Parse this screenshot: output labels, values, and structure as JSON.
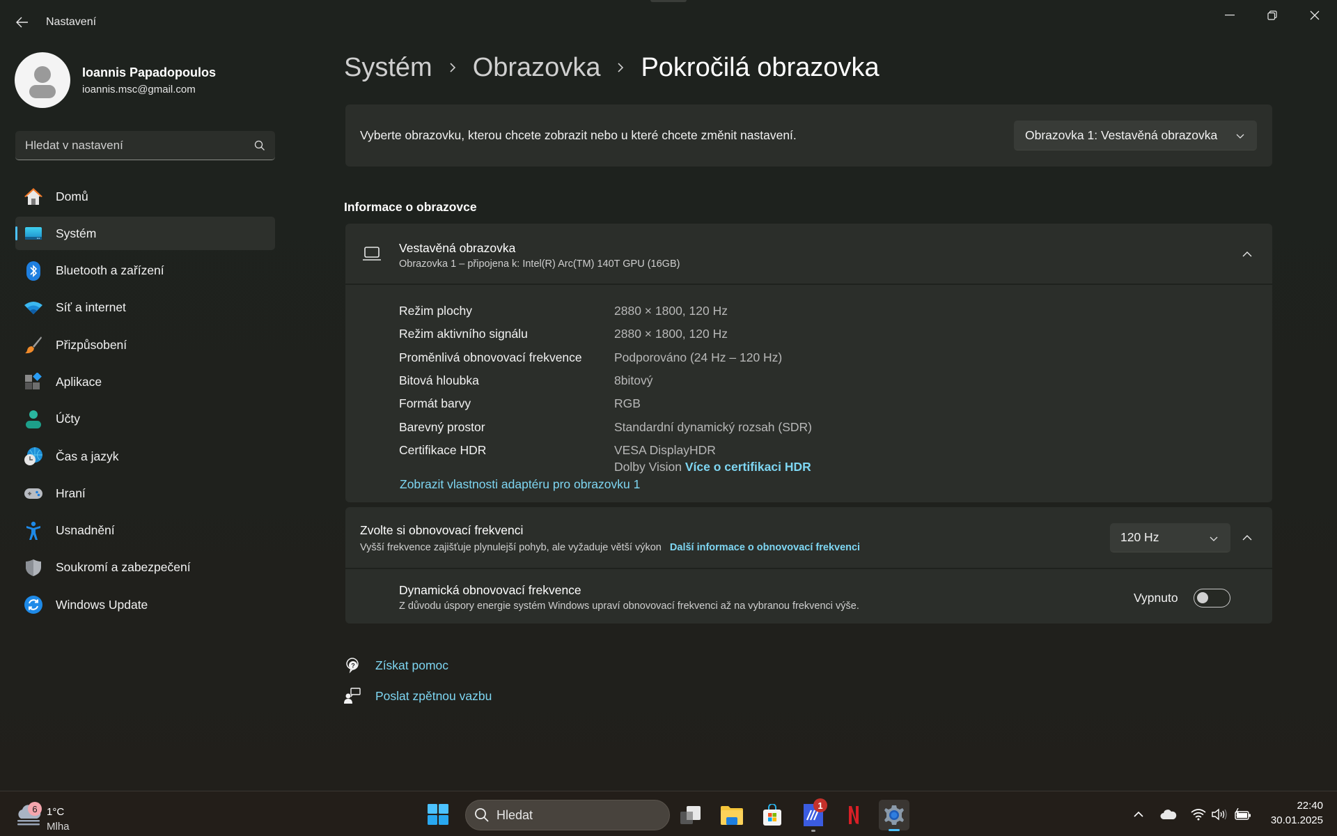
{
  "window": {
    "app_title": "Nastavení",
    "controls": {
      "minimize": "minimize",
      "maximize": "restore",
      "close": "close"
    }
  },
  "user": {
    "name": "Ioannis Papadopoulos",
    "email": "ioannis.msc@gmail.com"
  },
  "search": {
    "placeholder": "Hledat v nastavení",
    "value": ""
  },
  "sidebar": {
    "items": [
      {
        "label": "Domů",
        "icon": "home-icon",
        "selected": false
      },
      {
        "label": "Systém",
        "icon": "system-display-icon",
        "selected": true
      },
      {
        "label": "Bluetooth a zařízení",
        "icon": "bluetooth-icon",
        "selected": false
      },
      {
        "label": "Síť a internet",
        "icon": "wifi-icon",
        "selected": false
      },
      {
        "label": "Přizpůsobení",
        "icon": "paintbrush-icon",
        "selected": false
      },
      {
        "label": "Aplikace",
        "icon": "apps-icon",
        "selected": false
      },
      {
        "label": "Účty",
        "icon": "accounts-icon",
        "selected": false
      },
      {
        "label": "Čas a jazyk",
        "icon": "time-language-icon",
        "selected": false
      },
      {
        "label": "Hraní",
        "icon": "gamepad-icon",
        "selected": false
      },
      {
        "label": "Usnadnění",
        "icon": "accessibility-icon",
        "selected": false
      },
      {
        "label": "Soukromí a zabezpečení",
        "icon": "shield-icon",
        "selected": false
      },
      {
        "label": "Windows Update",
        "icon": "windows-update-icon",
        "selected": false
      }
    ]
  },
  "breadcrumb": {
    "items": [
      "Systém",
      "Obrazovka",
      "Pokročilá obrazovka"
    ]
  },
  "display_select": {
    "description": "Vyberte obrazovku, kterou chcete zobrazit nebo u které chcete změnit nastavení.",
    "selected": "Obrazovka 1: Vestavěná obrazovka"
  },
  "display_info": {
    "section_title": "Informace o obrazovce",
    "title": "Vestavěná obrazovka",
    "subtitle": "Obrazovka 1 – připojena k: Intel(R) Arc(TM) 140T GPU (16GB)",
    "expanded": true,
    "specs": [
      {
        "label": "Režim plochy",
        "value": "2880 × 1800, 120 Hz"
      },
      {
        "label": "Režim aktivního signálu",
        "value": "2880 × 1800, 120 Hz"
      },
      {
        "label": "Proměnlivá obnovovací frekvence",
        "value": "Podporováno (24 Hz – 120 Hz)"
      },
      {
        "label": "Bitová hloubka",
        "value": "8bitový"
      },
      {
        "label": "Formát barvy",
        "value": "RGB"
      },
      {
        "label": "Barevný prostor",
        "value": "Standardní dynamický rozsah (SDR)"
      },
      {
        "label": "Certifikace HDR",
        "value": "VESA DisplayHDR",
        "value2": "Dolby Vision",
        "link": "Více o certifikaci HDR"
      }
    ],
    "adapter_link": "Zobrazit vlastnosti adaptéru pro obrazovku 1"
  },
  "refresh_rate": {
    "title": "Zvolte si obnovovací frekvenci",
    "subtitle": "Vyšší frekvence zajišťuje plynulejší pohyb, ale vyžaduje větší výkon",
    "link": "Další informace o obnovovací frekvenci",
    "selected": "120 Hz",
    "dynamic": {
      "title": "Dynamická obnovovací frekvence",
      "subtitle": "Z důvodu úspory energie systém Windows upraví obnovovací frekvenci až na vybranou frekvenci výše.",
      "state_label": "Vypnuto",
      "enabled": false
    }
  },
  "help": {
    "get_help": "Získat pomoc",
    "feedback": "Poslat zpětnou vazbu"
  },
  "taskbar": {
    "weather": {
      "temp": "1°C",
      "desc": "Mlha",
      "badge": "6"
    },
    "search_label": "Hledat",
    "apps": [
      {
        "name": "task-view",
        "badge": null
      },
      {
        "name": "file-explorer",
        "badge": null
      },
      {
        "name": "microsoft-store",
        "badge": null
      },
      {
        "name": "app-with-badge",
        "badge": "1"
      },
      {
        "name": "netflix",
        "badge": null
      },
      {
        "name": "settings",
        "badge": null,
        "active": true
      }
    ],
    "time": "22:40",
    "date": "30.01.2025"
  },
  "colors": {
    "accent": "#4cc2ff",
    "link": "#7ed6f2",
    "card_bg": "#2b2e2a",
    "window_bg": "#1f231f"
  }
}
